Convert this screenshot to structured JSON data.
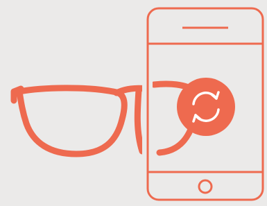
{
  "illustration": {
    "icons": [
      "eyeglasses-icon",
      "smartphone-icon",
      "sync-icon"
    ]
  },
  "colors": {
    "background": "#EBEAE9",
    "accent": "#EE6A4F",
    "icon_glyph": "#FFFFFF"
  }
}
